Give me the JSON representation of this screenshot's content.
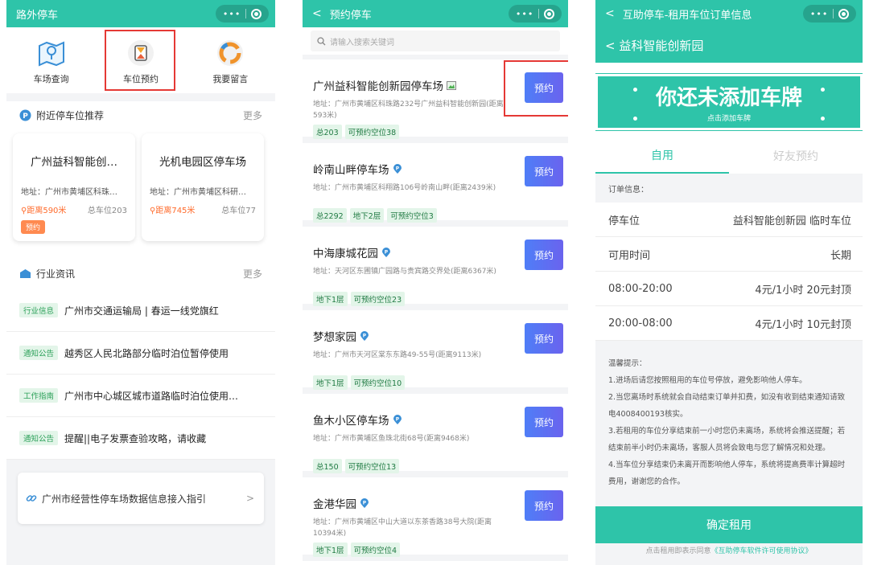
{
  "panel1": {
    "title": "路外停车",
    "menu": [
      {
        "label": "车场查询",
        "icon": "map-icon"
      },
      {
        "label": "车位预约",
        "icon": "hourglass-icon"
      },
      {
        "label": "我要留言",
        "icon": "message-icon"
      }
    ],
    "nearby": {
      "title": "附近停车位推荐",
      "more": "更多",
      "cards": [
        {
          "name": "广州益科智能创…",
          "addr": "地址：广州市黄埔区科珠…",
          "dist": "距离590米",
          "total": "总车位203",
          "badge": "预约"
        },
        {
          "name": "光机电园区停车场",
          "addr": "地址：广州市黄埔区科研…",
          "dist": "距离745米",
          "total": "总车位77",
          "badge": ""
        }
      ]
    },
    "news": {
      "title": "行业资讯",
      "more": "更多",
      "items": [
        {
          "tag": "行业信息",
          "text": "广州市交通运输局 | 春运一线党旗红"
        },
        {
          "tag": "通知公告",
          "text": "越秀区人民北路部分临时泊位暂停使用"
        },
        {
          "tag": "工作指南",
          "text": "广州市中心城区城市道路临时泊位使用…"
        },
        {
          "tag": "通知公告",
          "text": "提醒||电子发票查验攻略，请收藏"
        }
      ]
    },
    "guide": {
      "text": "广州市经营性停车场数据信息接入指引",
      "arrow": ">"
    }
  },
  "panel2": {
    "title": "预约停车",
    "back": "<",
    "search_placeholder": "请输入搜索关键词",
    "button_label": "预约",
    "lots": [
      {
        "name": "广州益科智能创新园停车场",
        "addr": "地址：广州市黄埔区科珠路232号广州益科智能创新园(距离593米)",
        "tags": [
          "总203",
          "可预约空位38"
        ]
      },
      {
        "name": "岭南山畔停车场",
        "addr": "地址：广州市黄埔区科翔路106号岭南山畔(距离2439米)",
        "tags": [
          "总2292",
          "地下2层",
          "可预约空位3"
        ]
      },
      {
        "name": "中海康城花园",
        "addr": "地址：天河区东圃镇广园路与贵宾路交界处(距离6367米)",
        "tags": [
          "地下1层",
          "可预约空位23"
        ]
      },
      {
        "name": "梦想家园",
        "addr": "地址：广州市天河区棠东东路49-55号(距离9113米)",
        "tags": [
          "地下1层",
          "可预约空位10"
        ]
      },
      {
        "name": "鱼木小区停车场",
        "addr": "地址：广州市黄埔区鱼珠北街68号(距离9468米)",
        "tags": [
          "总150",
          "可预约空位13"
        ]
      },
      {
        "name": "金港华园",
        "addr": "地址：广州市黄埔区中山大道以东茶香路38号大院(距离10394米)",
        "tags": [
          "地下1层",
          "可预约空位4"
        ]
      }
    ]
  },
  "panel3": {
    "title": "互助停车-租用车位订单信息",
    "back": "<",
    "subtitle": "< 益科智能创新园",
    "plate_big": "你还未添加车牌",
    "plate_small": "点击添加车牌",
    "tabs": [
      "自用",
      "好友预约"
    ],
    "order_label": "订单信息：",
    "rows": [
      {
        "k": "停车位",
        "v": "益科智能创新园 临时车位"
      },
      {
        "k": "可用时间",
        "v": "长期"
      },
      {
        "k": "08:00-20:00",
        "v": "4元/1小时 20元封顶"
      },
      {
        "k": "20:00-08:00",
        "v": "4元/1小时 10元封顶"
      }
    ],
    "tips": [
      "温馨提示：",
      "1.进场后请您按照租用的车位号停放，避免影响他人停车。",
      "2.当您离场时系统就会自动结束订单并扣费，如没有收到结束通知请致电4008400193核实。",
      "3.若租用的车位分享结束前一小时您仍未离场，系统将会推送提醒；若结束前半小时仍未离场，客服人员将会致电与您了解情况和处理。",
      "4.当车位分享结束仍未离开而影响他人停车，系统将提高费率计算超时费用，谢谢您的合作。"
    ],
    "confirm": "确定租用",
    "agree_prefix": "点击租用即表示同意",
    "agree_link": "《互助停车软件许可使用协议》"
  },
  "colors": {
    "brand": "#2ec4a9",
    "button": "#5a72f3",
    "highlight": "#e53935",
    "distance": "#ff6b2c"
  }
}
